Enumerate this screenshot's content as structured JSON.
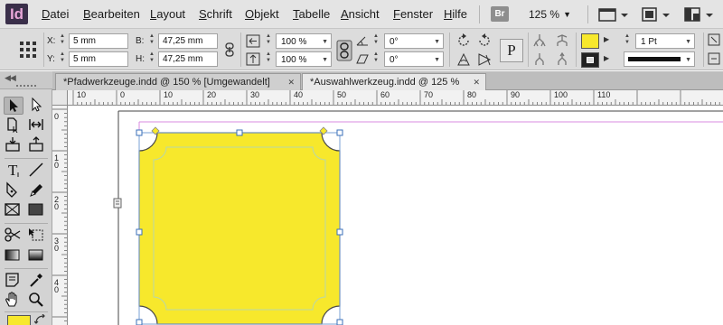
{
  "app": {
    "logo": "Id"
  },
  "menu": [
    "Datei",
    "Bearbeiten",
    "Layout",
    "Schrift",
    "Objekt",
    "Tabelle",
    "Ansicht",
    "Fenster",
    "Hilfe"
  ],
  "menubar": {
    "bridge_label": "Br",
    "zoom": "125 %"
  },
  "control": {
    "x_label": "X:",
    "x_value": "5 mm",
    "y_label": "Y:",
    "y_value": "5 mm",
    "w_label": "B:",
    "w_value": "47,25 mm",
    "h_label": "H:",
    "h_value": "47,25 mm",
    "scale_x": "100 %",
    "scale_y": "100 %",
    "rotate": "0°",
    "shear": "0°",
    "stroke_weight": "1 Pt",
    "fill_color": "#f7e82c",
    "text_wrap_label": "P"
  },
  "tabs": [
    {
      "label": "*Pfadwerkzeuge.indd @ 150 % [Umgewandelt]",
      "active": false
    },
    {
      "label": "*Auswahlwerkzeug.indd @ 125 %",
      "active": true
    }
  ],
  "ruler": {
    "h_labels": [
      "10",
      "0",
      "10",
      "20",
      "30",
      "40",
      "50",
      "60",
      "70",
      "80",
      "90",
      "100",
      "110"
    ],
    "v_labels": [
      "0",
      "1 0",
      "2 0",
      "3 0",
      "4 0"
    ]
  },
  "shape": {
    "fill": "#f7e82c",
    "stroke": "#4a4a4a"
  },
  "icons": {
    "selection": "selection-arrow-icon",
    "direct_selection": "direct-selection-icon",
    "page": "page-tool-icon",
    "gap": "gap-tool-icon",
    "content_collector": "content-collector-icon",
    "content_placer": "content-placer-icon",
    "type": "type-tool-icon",
    "line": "line-tool-icon",
    "pen": "pen-tool-icon",
    "pencil": "pencil-tool-icon",
    "rect_frame": "rectangle-frame-icon",
    "rect": "rectangle-tool-icon",
    "scissors": "scissors-icon",
    "free_transform": "free-transform-icon",
    "gradient_swatch": "gradient-swatch-icon",
    "gradient_feather": "gradient-feather-icon",
    "note": "note-tool-icon",
    "eyedropper": "eyedropper-icon",
    "hand": "hand-tool-icon",
    "zoom": "zoom-tool-icon"
  }
}
